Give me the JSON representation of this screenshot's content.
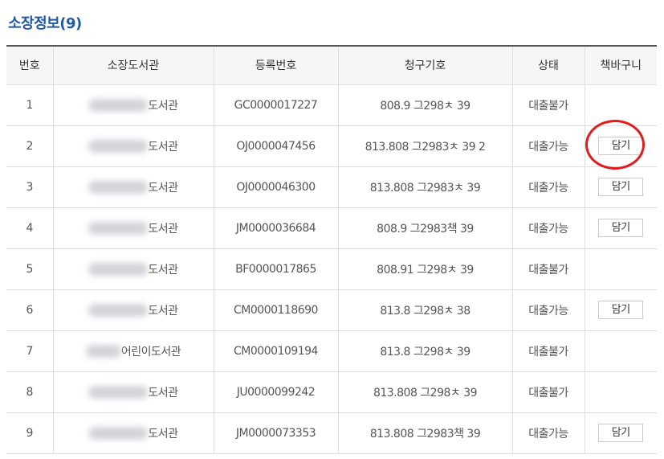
{
  "section": {
    "title": "소장정보(9)"
  },
  "table": {
    "headers": [
      "번호",
      "소장도서관",
      "등록번호",
      "청구기호",
      "상태",
      "책바구니"
    ],
    "rows": [
      {
        "no": "1",
        "library": "도서관",
        "reg_no": "GC0000017227",
        "call_no": "808.9 그298ㅊ 39",
        "status": "대출불가",
        "cart": ""
      },
      {
        "no": "2",
        "library": "도서관",
        "reg_no": "OJ0000047456",
        "call_no": "813.808 그2983ㅊ 39 2",
        "status": "대출가능",
        "cart": "담기"
      },
      {
        "no": "3",
        "library": "도서관",
        "reg_no": "OJ0000046300",
        "call_no": "813.808 그2983ㅊ 39",
        "status": "대출가능",
        "cart": "담기"
      },
      {
        "no": "4",
        "library": "도서관",
        "reg_no": "JM0000036684",
        "call_no": "808.9 그2983책 39",
        "status": "대출가능",
        "cart": "담기"
      },
      {
        "no": "5",
        "library": "도서관",
        "reg_no": "BF0000017865",
        "call_no": "808.91 그298ㅊ 39",
        "status": "대출불가",
        "cart": ""
      },
      {
        "no": "6",
        "library": "도서관",
        "reg_no": "CM0000118690",
        "call_no": "813.8 그298ㅊ 38",
        "status": "대출가능",
        "cart": "담기"
      },
      {
        "no": "7",
        "library": "어린이도서관",
        "reg_no": "CM0000109194",
        "call_no": "813.8 그298ㅊ 39",
        "status": "대출불가",
        "cart": ""
      },
      {
        "no": "8",
        "library": "도서관",
        "reg_no": "JU0000099242",
        "call_no": "813.808 그298ㅊ 39",
        "status": "대출불가",
        "cart": ""
      },
      {
        "no": "9",
        "library": "도서관",
        "reg_no": "JM0000073353",
        "call_no": "813.808 그2983책 39",
        "status": "대출가능",
        "cart": "담기"
      }
    ]
  },
  "annotation": {
    "circle_color": "#e31b1b"
  },
  "colors": {
    "title": "#1f5aa6",
    "header_border": "#555555"
  }
}
